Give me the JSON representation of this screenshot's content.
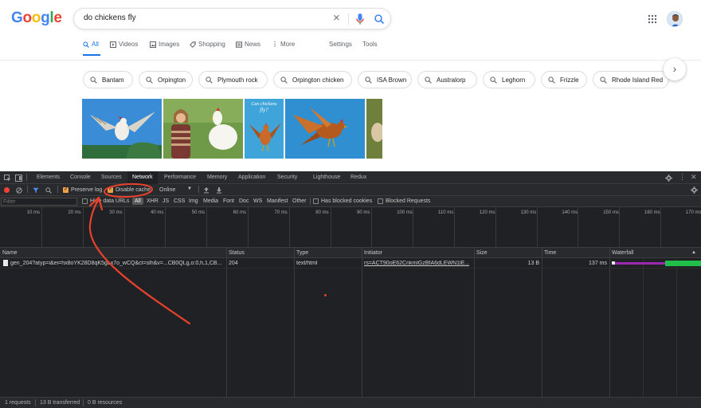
{
  "google": {
    "logo_letters": [
      {
        "ch": "G",
        "color": "#4285f4"
      },
      {
        "ch": "o",
        "color": "#ea4335"
      },
      {
        "ch": "o",
        "color": "#fbbc05"
      },
      {
        "ch": "g",
        "color": "#4285f4"
      },
      {
        "ch": "l",
        "color": "#34a853"
      },
      {
        "ch": "e",
        "color": "#ea4335"
      }
    ],
    "search_query": "do chickens fly",
    "tabs": [
      {
        "label": "All",
        "icon": "search-icon",
        "active": true
      },
      {
        "label": "Videos",
        "icon": "video-icon"
      },
      {
        "label": "Images",
        "icon": "image-icon"
      },
      {
        "label": "Shopping",
        "icon": "tag-icon"
      },
      {
        "label": "News",
        "icon": "news-icon"
      },
      {
        "label": "More",
        "icon": "more-vertical-icon"
      },
      {
        "label": "Settings"
      },
      {
        "label": "Tools"
      }
    ],
    "chips": [
      "Bantam",
      "Orpington",
      "Plymouth rock",
      "Orpington chicken",
      "ISA Brown",
      "Australorp",
      "Leghorn",
      "Frizzle",
      "Rhode Island Red"
    ],
    "image_caption": "Can chickens fly?",
    "accent": "#1a73e8"
  },
  "devtools": {
    "tabs": [
      "Elements",
      "Console",
      "Sources",
      "Network",
      "Performance",
      "Memory",
      "Application",
      "Security",
      "Lighthouse",
      "Redux"
    ],
    "active_tab": "Network",
    "toolbar": {
      "preserve_log": "Preserve log",
      "disable_cache": "Disable cache",
      "throttle": "Online"
    },
    "filter": {
      "placeholder": "Filter",
      "hide_data_urls": "Hide data URLs",
      "all": "All",
      "types": [
        "XHR",
        "JS",
        "CSS",
        "Img",
        "Media",
        "Font",
        "Doc",
        "WS",
        "Manifest",
        "Other"
      ],
      "has_blocked_cookies": "Has blocked cookies",
      "blocked_requests": "Blocked Requests"
    },
    "timeline_ticks": [
      "10 ms",
      "20 ms",
      "30 ms",
      "40 ms",
      "50 ms",
      "60 ms",
      "70 ms",
      "80 ms",
      "90 ms",
      "100 ms",
      "110 ms",
      "120 ms",
      "130 ms",
      "140 ms",
      "150 ms",
      "160 ms",
      "170 ms"
    ],
    "columns": [
      "Name",
      "Status",
      "Type",
      "Initiator",
      "Size",
      "Time",
      "Waterfall"
    ],
    "rows": [
      {
        "name": "gen_204?atyp=i&ei=hx8oYK28D8qK5gLx7o_wCQ&ct=slh&v=...CB0QLg,o:0,h,1,CB...",
        "status": "204",
        "type": "text/html",
        "initiator": "rs=ACT90oE62CnkmlGzBfA6dLEWN1lE...",
        "size": "13 B",
        "time": "137 ms"
      }
    ],
    "statusbar": {
      "requests": "1 requests",
      "transferred": "13 B transferred",
      "resources": "0 B resources"
    },
    "colors": {
      "record": "#f44336",
      "checkbox": "#f0a045",
      "waterfall_wait": "#9c27b0",
      "waterfall_download": "#1fbf4a"
    }
  },
  "annotation": {
    "color": "#e8412c"
  }
}
